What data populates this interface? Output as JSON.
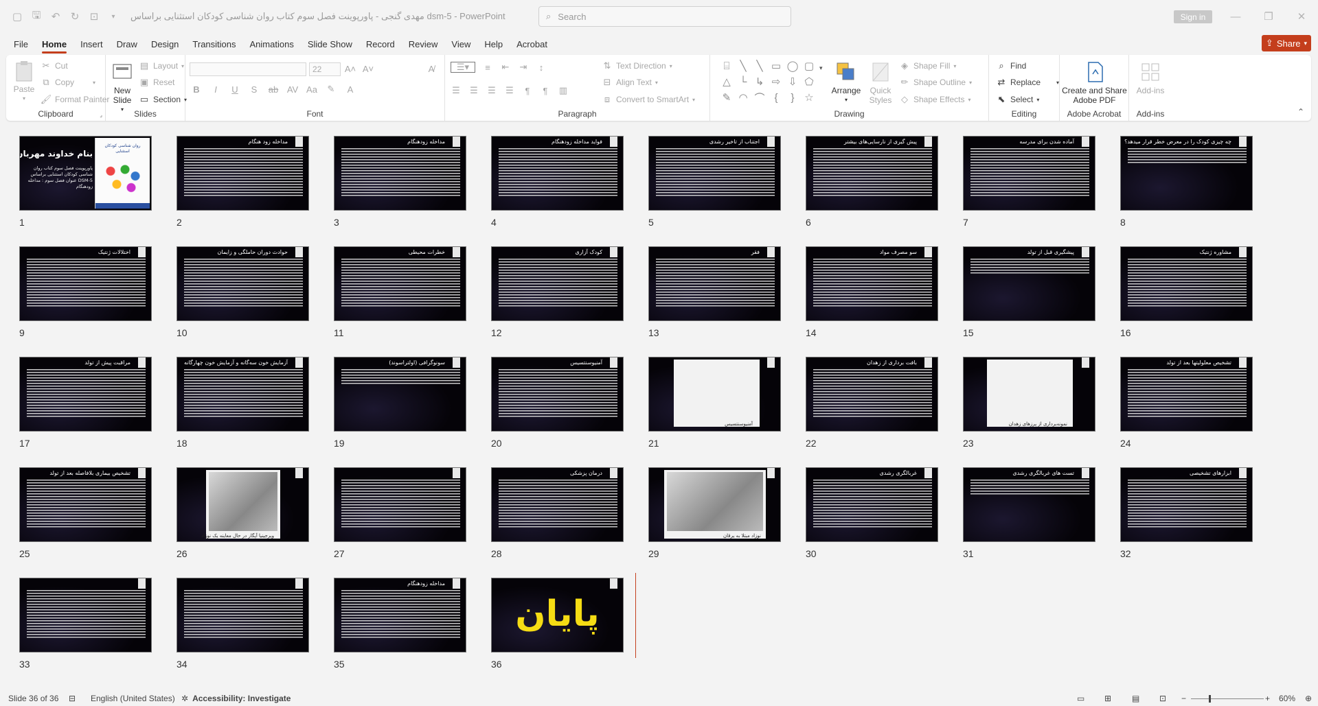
{
  "window": {
    "title": "مهدی گنجی - پاورپوینت فصل سوم کتاب روان شناسی کودکان استثنایی براساس dsm-5  -  PowerPoint",
    "search_placeholder": "Search",
    "signin_label": "Sign in"
  },
  "menu": {
    "tabs": [
      "File",
      "Home",
      "Insert",
      "Draw",
      "Design",
      "Transitions",
      "Animations",
      "Slide Show",
      "Record",
      "Review",
      "View",
      "Help",
      "Acrobat"
    ],
    "active_tab": "Home",
    "share_label": "Share"
  },
  "ribbon": {
    "clipboard": {
      "label": "Clipboard",
      "paste": "Paste",
      "cut": "Cut",
      "copy": "Copy",
      "format_painter": "Format Painter"
    },
    "slides": {
      "label": "Slides",
      "new_slide": "New Slide",
      "layout": "Layout",
      "reset": "Reset",
      "section": "Section"
    },
    "font": {
      "label": "Font",
      "font_name": "",
      "font_size": "22"
    },
    "paragraph": {
      "label": "Paragraph",
      "text_direction": "Text Direction",
      "align_text": "Align Text",
      "convert_smartart": "Convert to SmartArt"
    },
    "drawing": {
      "label": "Drawing",
      "arrange": "Arrange",
      "quick_styles": "Quick Styles",
      "shape_fill": "Shape Fill",
      "shape_outline": "Shape Outline",
      "shape_effects": "Shape Effects"
    },
    "editing": {
      "label": "Editing",
      "find": "Find",
      "replace": "Replace",
      "select": "Select"
    },
    "acrobat": {
      "label": "Adobe Acrobat",
      "create_share": "Create and Share Adobe PDF"
    },
    "addins": {
      "label": "Add-ins",
      "addins_btn": "Add-ins"
    }
  },
  "slides": [
    {
      "n": "1",
      "type": "cover",
      "title": "بنام خداوند مهربان",
      "subtitle": "پاورپوینت فصل سوم کتاب روان شناسی کودکان استثنایی براساس DSM-5 عنوان فصل سوم : مداخله زودهنگام",
      "book_title": "روان شناسی کودکان استثنایی"
    },
    {
      "n": "2",
      "type": "text",
      "title": "مداخله زود هنگام"
    },
    {
      "n": "3",
      "type": "text",
      "title": "مداخله زودهنگام"
    },
    {
      "n": "4",
      "type": "text",
      "title": "فواید مداخله زودهنگام"
    },
    {
      "n": "5",
      "type": "text",
      "title": "اجتناب از تاخیر رشدی"
    },
    {
      "n": "6",
      "type": "text",
      "title": "پیش گیری از نارسایی‌های بیشتر"
    },
    {
      "n": "7",
      "type": "text",
      "title": "آماده شدن برای مدرسه"
    },
    {
      "n": "8",
      "type": "short",
      "title": "چه چیزی کودک را در معرض خطر قرار میدهد؟"
    },
    {
      "n": "9",
      "type": "text",
      "title": "اختلالات ژنتیک"
    },
    {
      "n": "10",
      "type": "text",
      "title": "حوادث دوران حاملگی و زایمان"
    },
    {
      "n": "11",
      "type": "text",
      "title": "خطرات محیطی"
    },
    {
      "n": "12",
      "type": "text",
      "title": "کودک آزاری"
    },
    {
      "n": "13",
      "type": "text",
      "title": "فقر"
    },
    {
      "n": "14",
      "type": "text",
      "title": "سو مصرف مواد"
    },
    {
      "n": "15",
      "type": "short",
      "title": "پیشگیری قبل از تولد"
    },
    {
      "n": "16",
      "type": "text",
      "title": "مشاوره ژنتیک"
    },
    {
      "n": "17",
      "type": "text",
      "title": "مراقبت پیش از تولد"
    },
    {
      "n": "18",
      "type": "text",
      "title": "آزمایش خون سه‌گانه و آزمایش خون چهارگانه"
    },
    {
      "n": "19",
      "type": "short",
      "title": "سونوگرافی (اولتراسوند)"
    },
    {
      "n": "20",
      "type": "text",
      "title": "آمنیوسنتسیس"
    },
    {
      "n": "21",
      "type": "image",
      "title": "",
      "caption": "آمنیوسنتسیس"
    },
    {
      "n": "22",
      "type": "text",
      "title": "بافت برداری از زهدان"
    },
    {
      "n": "23",
      "type": "image",
      "title": "",
      "caption": "نمونه‌برداری از پرزهای زهدان"
    },
    {
      "n": "24",
      "type": "text",
      "title": "تشخیص معلولیتها بعد از تولد"
    },
    {
      "n": "25",
      "type": "text",
      "title": "تشخیص بیماری بلافاصله بعد از تولد"
    },
    {
      "n": "26",
      "type": "photo",
      "title": "",
      "caption": "ویرجینیا آپگار در حال معاینه یک نوزاد"
    },
    {
      "n": "27",
      "type": "text",
      "title": ""
    },
    {
      "n": "28",
      "type": "text",
      "title": "درمان پزشکی"
    },
    {
      "n": "29",
      "type": "photo",
      "title": "",
      "caption": "نوزاد مبتلا به یرقان"
    },
    {
      "n": "30",
      "type": "text",
      "title": "غربالگری رشدی"
    },
    {
      "n": "31",
      "type": "short",
      "title": "تست های غربالگری رشدی"
    },
    {
      "n": "32",
      "type": "text",
      "title": "ابزارهای تشخیصی"
    },
    {
      "n": "33",
      "type": "text",
      "title": ""
    },
    {
      "n": "34",
      "type": "text",
      "title": ""
    },
    {
      "n": "35",
      "type": "text",
      "title": "مداخله زودهنگام"
    },
    {
      "n": "36",
      "type": "end",
      "title": "پایان"
    }
  ],
  "statusbar": {
    "slide_info": "Slide 36 of 36",
    "language": "English (United States)",
    "accessibility": "Accessibility: Investigate",
    "zoom": "60%"
  },
  "colors": {
    "accent": "#c43e1c",
    "slide_bg": "#050308",
    "end_text": "#f5dc14"
  }
}
